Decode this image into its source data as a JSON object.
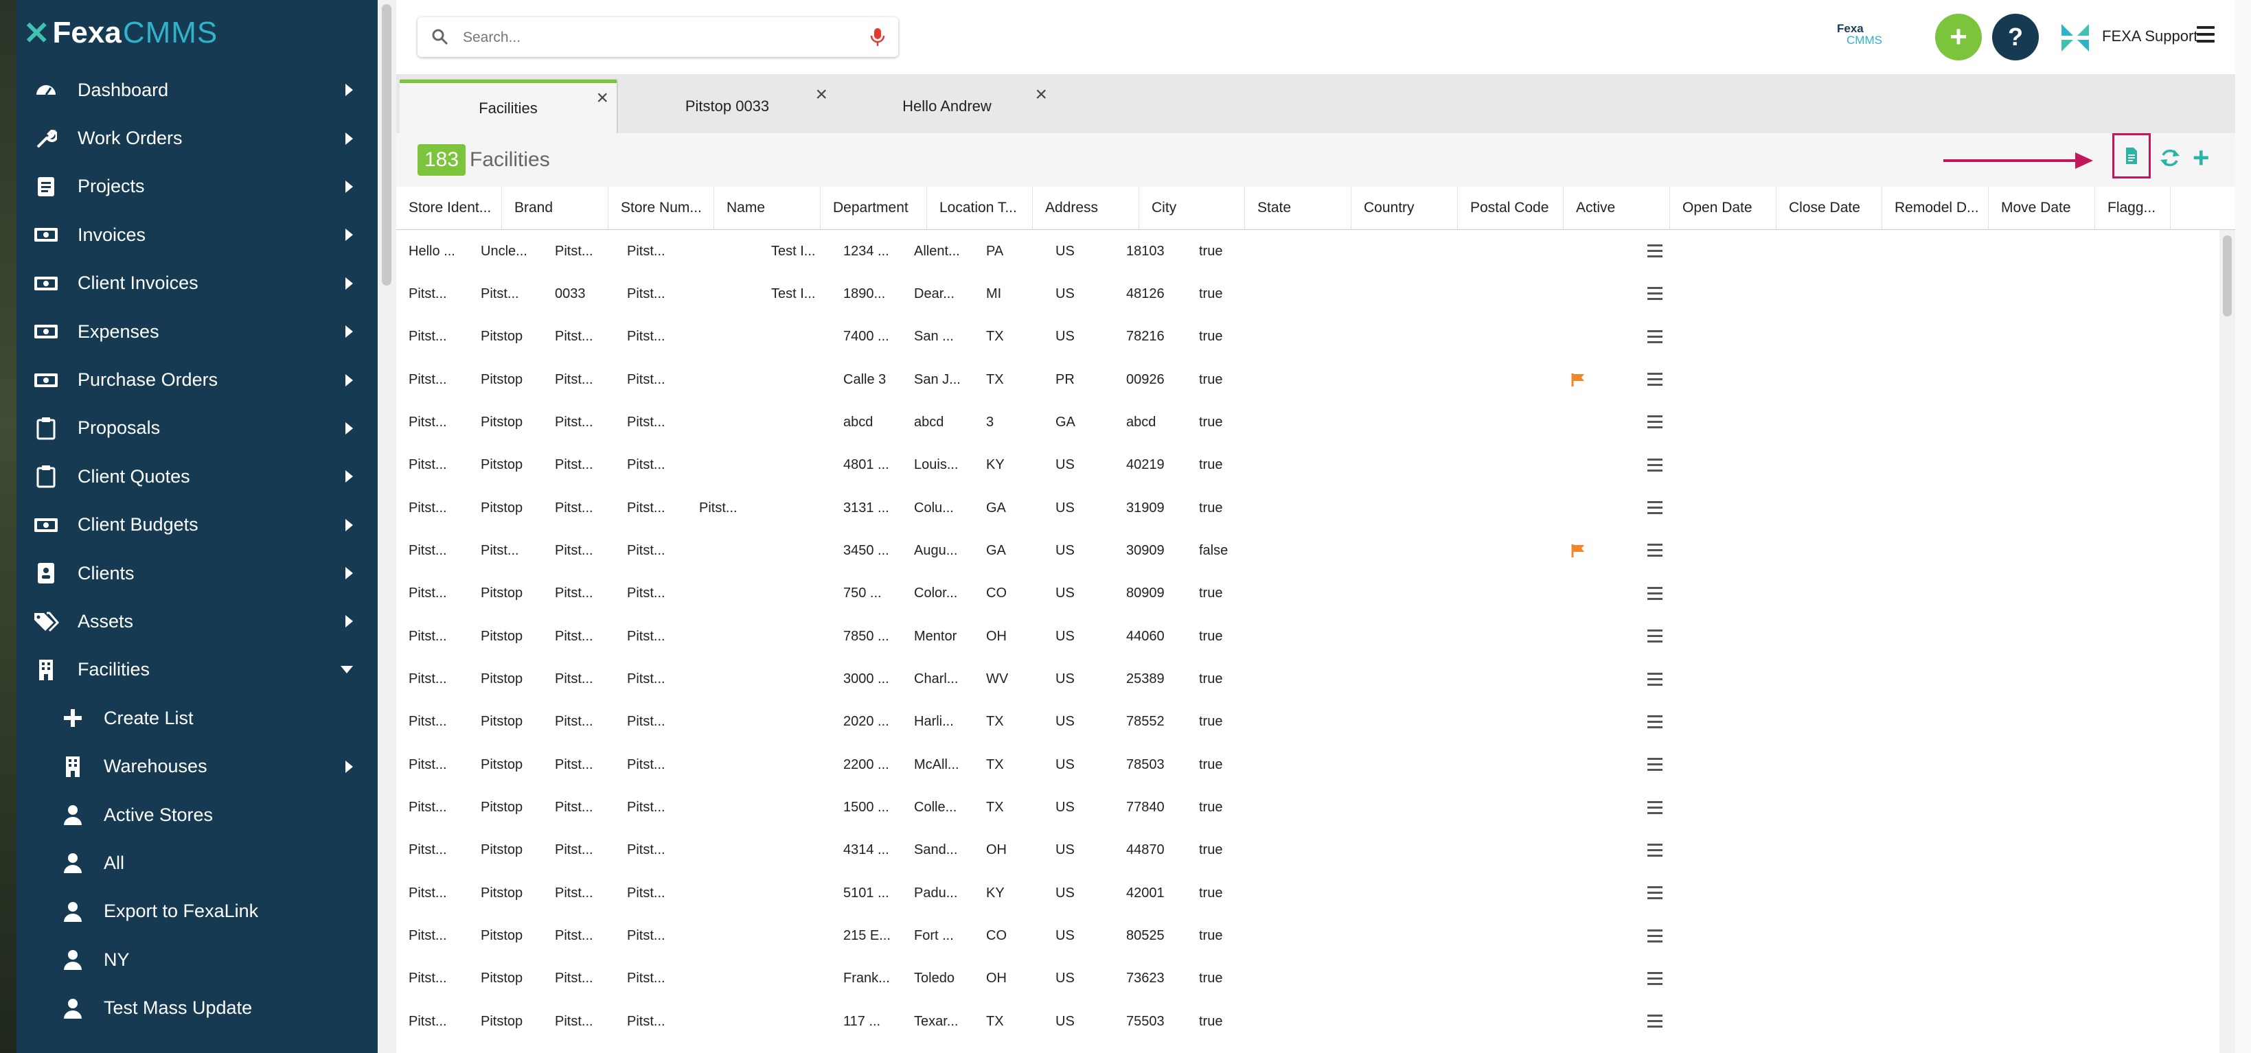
{
  "app": {
    "logo_text": "Fexa",
    "logo_suffix": "CMMS",
    "user_name": "FEXA Support",
    "mini_logo_top": "Fexa",
    "mini_logo_bottom": "CMMS",
    "add_label": "+",
    "help_label": "?"
  },
  "search": {
    "placeholder": "Search..."
  },
  "sidebar": {
    "items": [
      {
        "label": "Dashboard",
        "icon": "dashboard-icon"
      },
      {
        "label": "Work Orders",
        "icon": "wrench-icon"
      },
      {
        "label": "Projects",
        "icon": "projects-icon"
      },
      {
        "label": "Invoices",
        "icon": "money-icon"
      },
      {
        "label": "Client Invoices",
        "icon": "money-icon"
      },
      {
        "label": "Expenses",
        "icon": "money-icon"
      },
      {
        "label": "Purchase Orders",
        "icon": "money-icon"
      },
      {
        "label": "Proposals",
        "icon": "clipboard-icon"
      },
      {
        "label": "Client Quotes",
        "icon": "clipboard-icon"
      },
      {
        "label": "Client Budgets",
        "icon": "money-icon"
      },
      {
        "label": "Clients",
        "icon": "contact-card-icon"
      },
      {
        "label": "Assets",
        "icon": "tags-icon"
      },
      {
        "label": "Facilities",
        "icon": "building-icon"
      }
    ],
    "facilities_sub": [
      {
        "label": "Create List",
        "icon": "plus-icon"
      },
      {
        "label": "Warehouses",
        "icon": "building-icon"
      },
      {
        "label": "Active Stores",
        "icon": "user-icon"
      },
      {
        "label": "All",
        "icon": "user-icon"
      },
      {
        "label": "Export to FexaLink",
        "icon": "user-icon"
      },
      {
        "label": "NY",
        "icon": "user-icon"
      },
      {
        "label": "Test Mass Update",
        "icon": "user-icon"
      }
    ]
  },
  "tabs": [
    {
      "label": "Facilities",
      "active": true
    },
    {
      "label": "Pitstop 0033",
      "active": false
    },
    {
      "label": "Hello Andrew",
      "active": false
    }
  ],
  "page": {
    "count": "183",
    "title": "Facilities"
  },
  "columns": [
    "Store Ident...",
    "Brand",
    "Store Num...",
    "Name",
    "Department",
    "Location T...",
    "Address",
    "City",
    "State",
    "Country",
    "Postal Code",
    "Active",
    "Open Date",
    "Close Date",
    "Remodel D...",
    "Move Date",
    "Flagg..."
  ],
  "colors": {
    "accent_green": "#7cc43c",
    "sidebar_navy": "#163a52",
    "flag_orange": "#f0872a",
    "highlight": "#c2185b",
    "teal": "#2bb3a4"
  },
  "rows": [
    {
      "c": [
        "Hello ...",
        "Uncle...",
        "Pitst...",
        "Pitst...",
        "",
        "Test I...",
        "1234 ...",
        "Allent...",
        "PA",
        "US",
        "18103",
        "true"
      ],
      "flag": false
    },
    {
      "c": [
        "Pitst...",
        "Pitst...",
        "0033",
        "Pitst...",
        "",
        "Test I...",
        "1890...",
        "Dear...",
        "MI",
        "US",
        "48126",
        "true"
      ],
      "flag": false
    },
    {
      "c": [
        "Pitst...",
        "Pitstop",
        "Pitst...",
        "Pitst...",
        "",
        "",
        "7400 ...",
        "San ...",
        "TX",
        "US",
        "78216",
        "true"
      ],
      "flag": false
    },
    {
      "c": [
        "Pitst...",
        "Pitstop",
        "Pitst...",
        "Pitst...",
        "",
        "",
        "Calle 3",
        "San J...",
        "TX",
        "PR",
        "00926",
        "true"
      ],
      "flag": true
    },
    {
      "c": [
        "Pitst...",
        "Pitstop",
        "Pitst...",
        "Pitst...",
        "",
        "",
        "abcd",
        "abcd",
        "3",
        "GA",
        "abcd",
        "true"
      ],
      "flag": false
    },
    {
      "c": [
        "Pitst...",
        "Pitstop",
        "Pitst...",
        "Pitst...",
        "",
        "",
        "4801 ...",
        "Louis...",
        "KY",
        "US",
        "40219",
        "true"
      ],
      "flag": false
    },
    {
      "c": [
        "Pitst...",
        "Pitstop",
        "Pitst...",
        "Pitst...",
        "Pitst...",
        "",
        "3131 ...",
        "Colu...",
        "GA",
        "US",
        "31909",
        "true"
      ],
      "flag": false
    },
    {
      "c": [
        "Pitst...",
        "Pitst...",
        "Pitst...",
        "Pitst...",
        "",
        "",
        "3450 ...",
        "Augu...",
        "GA",
        "US",
        "30909",
        "false"
      ],
      "flag": true
    },
    {
      "c": [
        "Pitst...",
        "Pitstop",
        "Pitst...",
        "Pitst...",
        "",
        "",
        "750 ...",
        "Color...",
        "CO",
        "US",
        "80909",
        "true"
      ],
      "flag": false
    },
    {
      "c": [
        "Pitst...",
        "Pitstop",
        "Pitst...",
        "Pitst...",
        "",
        "",
        "7850 ...",
        "Mentor",
        "OH",
        "US",
        "44060",
        "true"
      ],
      "flag": false
    },
    {
      "c": [
        "Pitst...",
        "Pitstop",
        "Pitst...",
        "Pitst...",
        "",
        "",
        "3000 ...",
        "Charl...",
        "WV",
        "US",
        "25389",
        "true"
      ],
      "flag": false
    },
    {
      "c": [
        "Pitst...",
        "Pitstop",
        "Pitst...",
        "Pitst...",
        "",
        "",
        "2020 ...",
        "Harli...",
        "TX",
        "US",
        "78552",
        "true"
      ],
      "flag": false
    },
    {
      "c": [
        "Pitst...",
        "Pitstop",
        "Pitst...",
        "Pitst...",
        "",
        "",
        "2200 ...",
        "McAll...",
        "TX",
        "US",
        "78503",
        "true"
      ],
      "flag": false
    },
    {
      "c": [
        "Pitst...",
        "Pitstop",
        "Pitst...",
        "Pitst...",
        "",
        "",
        "1500 ...",
        "Colle...",
        "TX",
        "US",
        "77840",
        "true"
      ],
      "flag": false
    },
    {
      "c": [
        "Pitst...",
        "Pitstop",
        "Pitst...",
        "Pitst...",
        "",
        "",
        "4314 ...",
        "Sand...",
        "OH",
        "US",
        "44870",
        "true"
      ],
      "flag": false
    },
    {
      "c": [
        "Pitst...",
        "Pitstop",
        "Pitst...",
        "Pitst...",
        "",
        "",
        "5101 ...",
        "Padu...",
        "KY",
        "US",
        "42001",
        "true"
      ],
      "flag": false
    },
    {
      "c": [
        "Pitst...",
        "Pitstop",
        "Pitst...",
        "Pitst...",
        "",
        "",
        "215 E...",
        "Fort ...",
        "CO",
        "US",
        "80525",
        "true"
      ],
      "flag": false
    },
    {
      "c": [
        "Pitst...",
        "Pitstop",
        "Pitst...",
        "Pitst...",
        "",
        "",
        "Frank...",
        "Toledo",
        "OH",
        "US",
        "73623",
        "true"
      ],
      "flag": false
    },
    {
      "c": [
        "Pitst...",
        "Pitstop",
        "Pitst...",
        "Pitst...",
        "",
        "",
        "117 ...",
        "Texar...",
        "TX",
        "US",
        "75503",
        "true"
      ],
      "flag": false
    }
  ]
}
